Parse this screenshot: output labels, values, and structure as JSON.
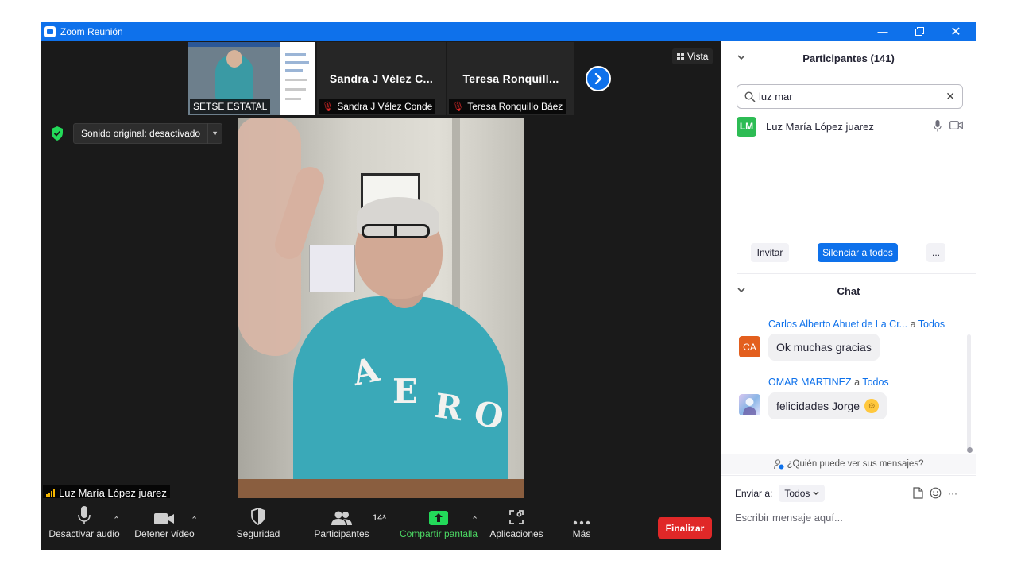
{
  "window": {
    "title": "Zoom Reunión"
  },
  "strip": {
    "tiles": [
      {
        "caption": "SETSE ESTATAL"
      },
      {
        "name_large": "Sandra J Vélez C...",
        "caption": "Sandra J Vélez Conde"
      },
      {
        "name_large": "Teresa Ronquill...",
        "caption": "Teresa Ronquillo Báez"
      }
    ],
    "view_label": "Vista"
  },
  "stage": {
    "original_sound": "Sonido original: desactivado",
    "speaker_name": "Luz María López juarez",
    "shirt_letters": [
      "A",
      "E",
      "R",
      "O"
    ]
  },
  "toolbar": {
    "mute_label": "Desactivar audio",
    "video_label": "Detener vídeo",
    "security_label": "Seguridad",
    "participants_label": "Participantes",
    "participants_count": "141",
    "share_label": "Compartir pantalla",
    "apps_label": "Aplicaciones",
    "more_label": "Más",
    "end_label": "Finalizar",
    "share_color": "#4cd964",
    "end_color": "#e02828"
  },
  "participants": {
    "header": "Participantes (141)",
    "search_value": "luz mar",
    "list": [
      {
        "initials": "LM",
        "name": "Luz María López juarez"
      }
    ],
    "invite_label": "Invitar",
    "mute_all_label": "Silenciar a todos",
    "more_label": "..."
  },
  "chat": {
    "header": "Chat",
    "messages": [
      {
        "initials": "CA",
        "from": "Carlos Alberto Ahuet de La Cr...",
        "to_prefix": "a",
        "to": "Todos",
        "text": "Ok muchas gracias"
      },
      {
        "from": "OMAR MARTINEZ",
        "to_prefix": "a",
        "to": "Todos",
        "text": "felicidades Jorge"
      }
    ],
    "who_can_see": "¿Quién puede ver sus mensajes?",
    "send_to_label": "Enviar a:",
    "send_to_value": "Todos",
    "more_label": "···",
    "placeholder": "Escribir mensaje aquí..."
  },
  "colors": {
    "accent": "#0e71eb",
    "titlebar": "#0e71eb"
  }
}
